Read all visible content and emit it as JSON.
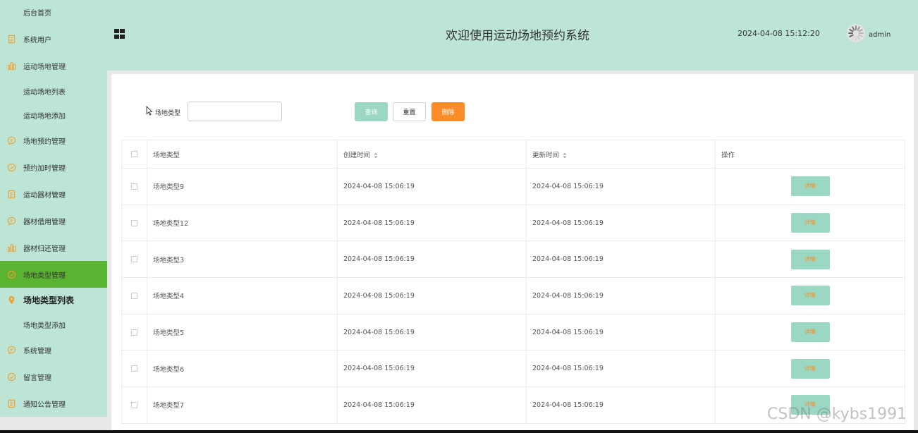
{
  "sidebar": {
    "items": [
      {
        "label": "后台首页",
        "icon": "home-icon"
      },
      {
        "label": "系统用户",
        "icon": "document-icon"
      },
      {
        "label": "运动场地管理",
        "icon": "bar-chart-icon"
      },
      {
        "label": "运动场地列表",
        "icon": ""
      },
      {
        "label": "运动场地添加",
        "icon": ""
      },
      {
        "label": "场地预约管理",
        "icon": "chat-icon"
      },
      {
        "label": "预约加时管理",
        "icon": "check-circle-icon"
      },
      {
        "label": "运动器材管理",
        "icon": "document-icon"
      },
      {
        "label": "器材借用管理",
        "icon": "chat-icon"
      },
      {
        "label": "器材归还管理",
        "icon": "bar-chart-icon"
      },
      {
        "label": "场地类型管理",
        "icon": "check-circle-icon"
      },
      {
        "label": "场地类型列表",
        "icon": "location-pin-icon"
      },
      {
        "label": "场地类型添加",
        "icon": ""
      },
      {
        "label": "系统管理",
        "icon": "chat-icon"
      },
      {
        "label": "留言管理",
        "icon": "check-circle-icon"
      },
      {
        "label": "通知公告管理",
        "icon": "document-icon"
      }
    ]
  },
  "header": {
    "title": "欢迎使用运动场地预约系统",
    "datetime": "2024-04-08 15:12:20",
    "username": "admin"
  },
  "search": {
    "label": "场地类型",
    "value": "",
    "query_button": "查询",
    "reset_button": "重置",
    "delete_button": "删除"
  },
  "table": {
    "columns": [
      "场地类型",
      "创建时间",
      "更新时间",
      "操作"
    ],
    "rows": [
      {
        "type": "场地类型9",
        "created": "2024-04-08 15:06:19",
        "updated": "2024-04-08 15:06:19",
        "action": "详情"
      },
      {
        "type": "场地类型12",
        "created": "2024-04-08 15:06:19",
        "updated": "2024-04-08 15:06:19",
        "action": "详情"
      },
      {
        "type": "场地类型3",
        "created": "2024-04-08 15:06:19",
        "updated": "2024-04-08 15:06:19",
        "action": "详情"
      },
      {
        "type": "场地类型4",
        "created": "2024-04-08 15:06:19",
        "updated": "2024-04-08 15:06:19",
        "action": "详情"
      },
      {
        "type": "场地类型5",
        "created": "2024-04-08 15:06:19",
        "updated": "2024-04-08 15:06:19",
        "action": "详情"
      },
      {
        "type": "场地类型6",
        "created": "2024-04-08 15:06:19",
        "updated": "2024-04-08 15:06:19",
        "action": "详情"
      },
      {
        "type": "场地类型7",
        "created": "2024-04-08 15:06:19",
        "updated": "2024-04-08 15:06:19",
        "action": "详情"
      }
    ]
  },
  "watermark": "CSDN @kybs1991",
  "colors": {
    "sidebar_bg": "#bde5d6",
    "active_item": "#5bb431",
    "accent_orange": "#fb8c28",
    "button_green": "#9bd8c3"
  }
}
